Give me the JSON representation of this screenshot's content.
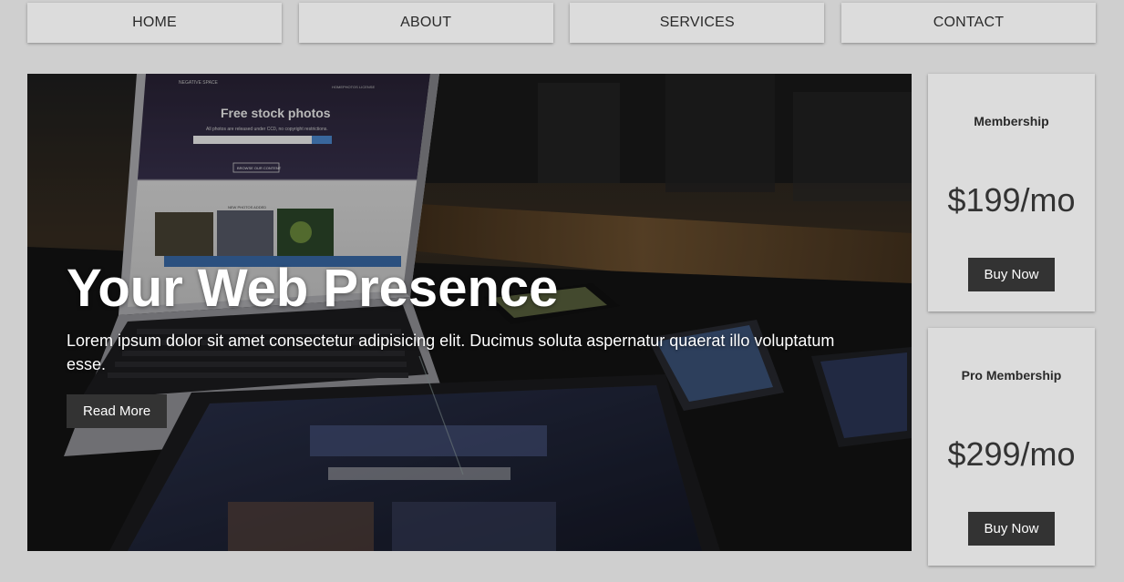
{
  "nav": {
    "items": [
      {
        "label": "HOME"
      },
      {
        "label": "ABOUT"
      },
      {
        "label": "SERVICES"
      },
      {
        "label": "CONTACT"
      }
    ]
  },
  "hero": {
    "title": "Your Web Presence",
    "text": "Lorem ipsum dolor sit amet consectetur adipisicing elit. Ducimus soluta aspernatur quaerat illo voluptatum esse.",
    "button_label": "Read More",
    "laptop_screen": {
      "heading": "Free stock photos",
      "subheading": "All photos are released under CC0, no copyright restrictions.",
      "button": "BROWSE OUR CONTENT",
      "section": "NEW PHOTOS ADDED",
      "brand": "NEGATIVE SPACE",
      "menu": [
        "HOME",
        "PHOTOS",
        "LICENSE"
      ]
    }
  },
  "pricing": [
    {
      "title": "Membership",
      "price": "$199/mo",
      "button_label": "Buy Now"
    },
    {
      "title": "Pro Membership",
      "price": "$299/mo",
      "button_label": "Buy Now"
    }
  ],
  "colors": {
    "page_bg": "#cfcfcf",
    "card_bg": "#dcdcdc",
    "button_bg": "#333333",
    "button_text": "#ffffff"
  }
}
